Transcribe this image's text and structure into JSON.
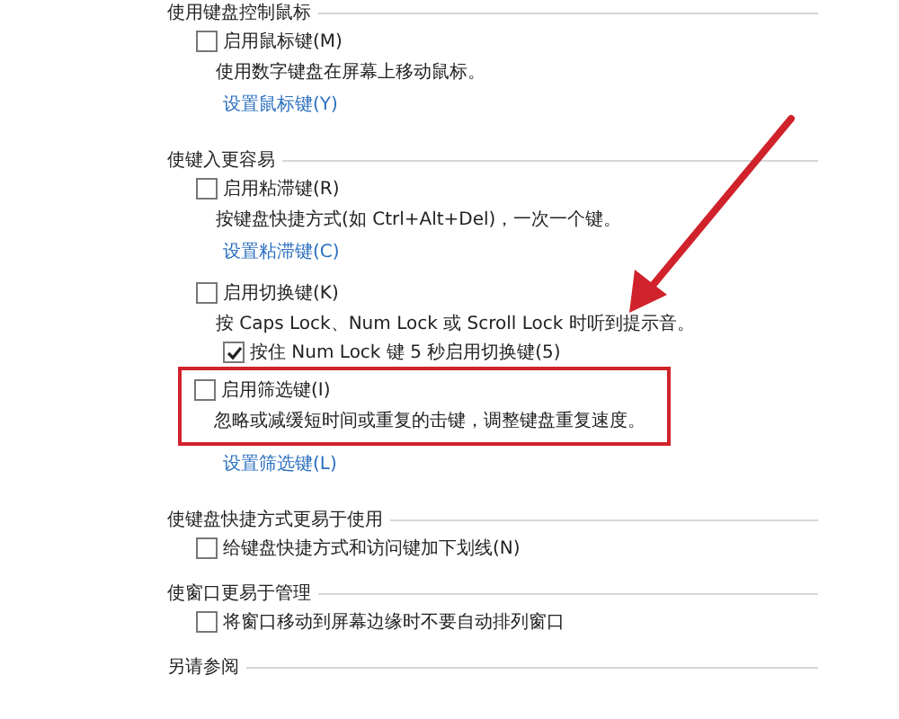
{
  "sections": [
    {
      "heading": "使用键盘控制鼠标",
      "items": [
        {
          "kind": "checkbox",
          "label": "启用鼠标键(M)",
          "checked": false
        },
        {
          "kind": "description",
          "text": "使用数字键盘在屏幕上移动鼠标。"
        },
        {
          "kind": "link",
          "text": "设置鼠标键(Y)"
        }
      ]
    },
    {
      "heading": "使键入更容易",
      "items": [
        {
          "kind": "checkbox",
          "label": "启用粘滞键(R)",
          "checked": false
        },
        {
          "kind": "description",
          "text": "按键盘快捷方式(如 Ctrl+Alt+Del)，一次一个键。"
        },
        {
          "kind": "link",
          "text": "设置粘滞键(C)"
        },
        {
          "kind": "checkbox",
          "label": "启用切换键(K)",
          "checked": false
        },
        {
          "kind": "description",
          "text": "按 Caps Lock、Num Lock 或 Scroll Lock 时听到提示音。"
        },
        {
          "kind": "subcheckbox",
          "label": "按住 Num Lock 键 5 秒启用切换键(5)",
          "checked": true
        },
        {
          "kind": "group",
          "highlighted": true,
          "items": [
            {
              "kind": "checkbox",
              "label": "启用筛选键(I)",
              "checked": false
            },
            {
              "kind": "description",
              "text": "忽略或减缓短时间或重复的击键，调整键盘重复速度。"
            }
          ]
        },
        {
          "kind": "link",
          "text": "设置筛选键(L)"
        }
      ]
    },
    {
      "heading": "使键盘快捷方式更易于使用",
      "items": [
        {
          "kind": "checkbox",
          "label": "给键盘快捷方式和访问键加下划线(N)",
          "checked": false
        }
      ]
    },
    {
      "heading": "使窗口更易于管理",
      "items": [
        {
          "kind": "checkbox",
          "label": "将窗口移动到屏幕边缘时不要自动排列窗口",
          "checked": false
        }
      ]
    },
    {
      "heading": "另请参阅"
    }
  ]
}
